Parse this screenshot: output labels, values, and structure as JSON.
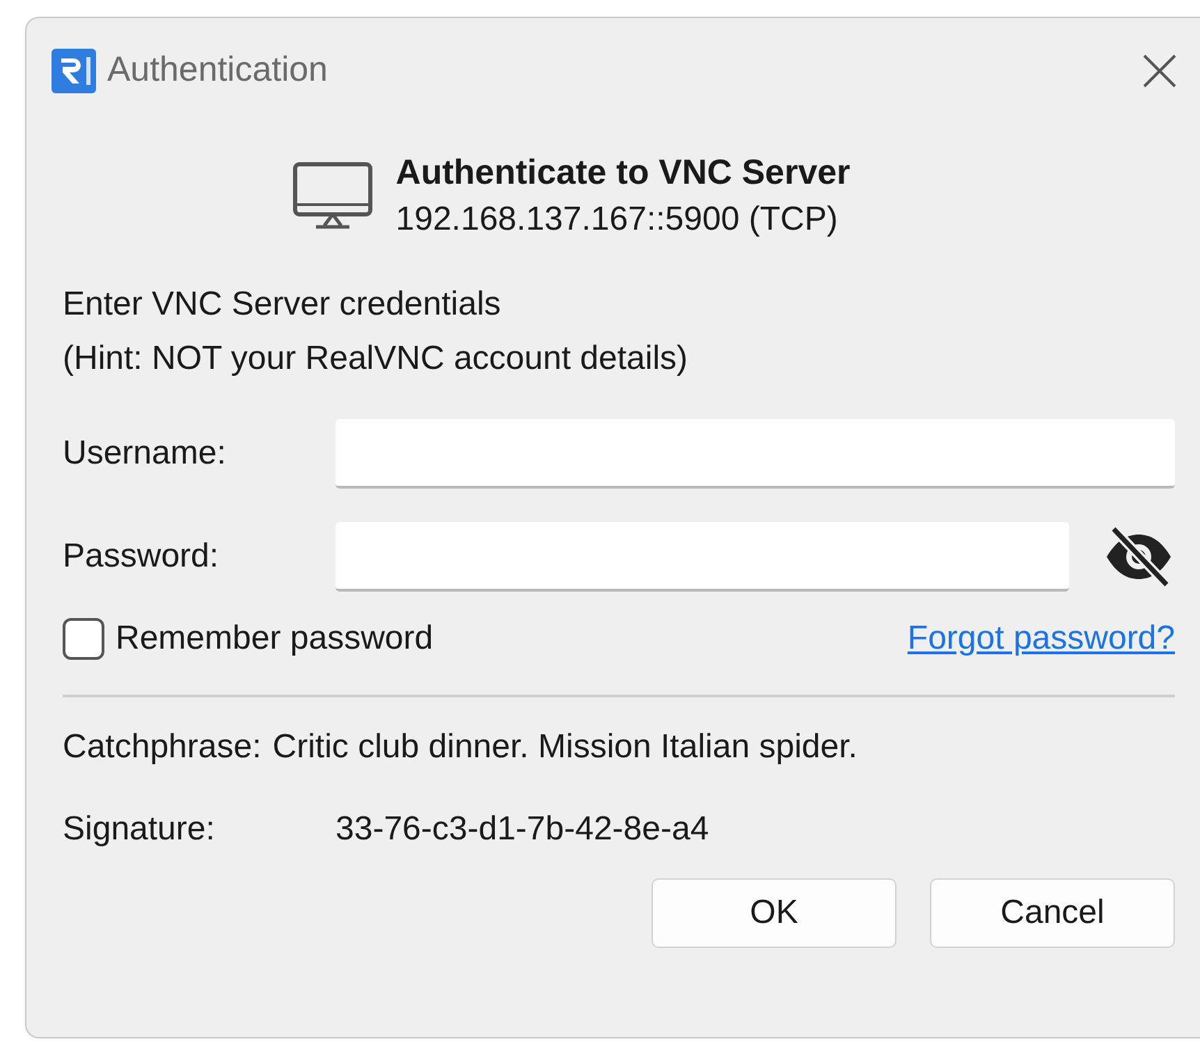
{
  "window": {
    "title": "Authentication"
  },
  "header": {
    "title": "Authenticate to VNC Server",
    "address": "192.168.137.167::5900 (TCP)"
  },
  "instructions": [
    "Enter VNC Server credentials",
    "(Hint: NOT your RealVNC account details)"
  ],
  "fields": [
    {
      "label": "Username:",
      "kind": "text"
    },
    {
      "label": "Password:",
      "kind": "password"
    }
  ],
  "remember": {
    "label": "Remember password",
    "checked": false
  },
  "link": "Forgot password?",
  "info": [
    {
      "label": "Catchphrase:",
      "value": "Critic club dinner. Mission Italian spider.",
      "kind": "inline"
    },
    {
      "label": "Signature:",
      "value": "33-76-c3-d1-7b-42-8e-a4",
      "kind": "aligned"
    }
  ],
  "buttons": [
    "OK",
    "Cancel"
  ]
}
